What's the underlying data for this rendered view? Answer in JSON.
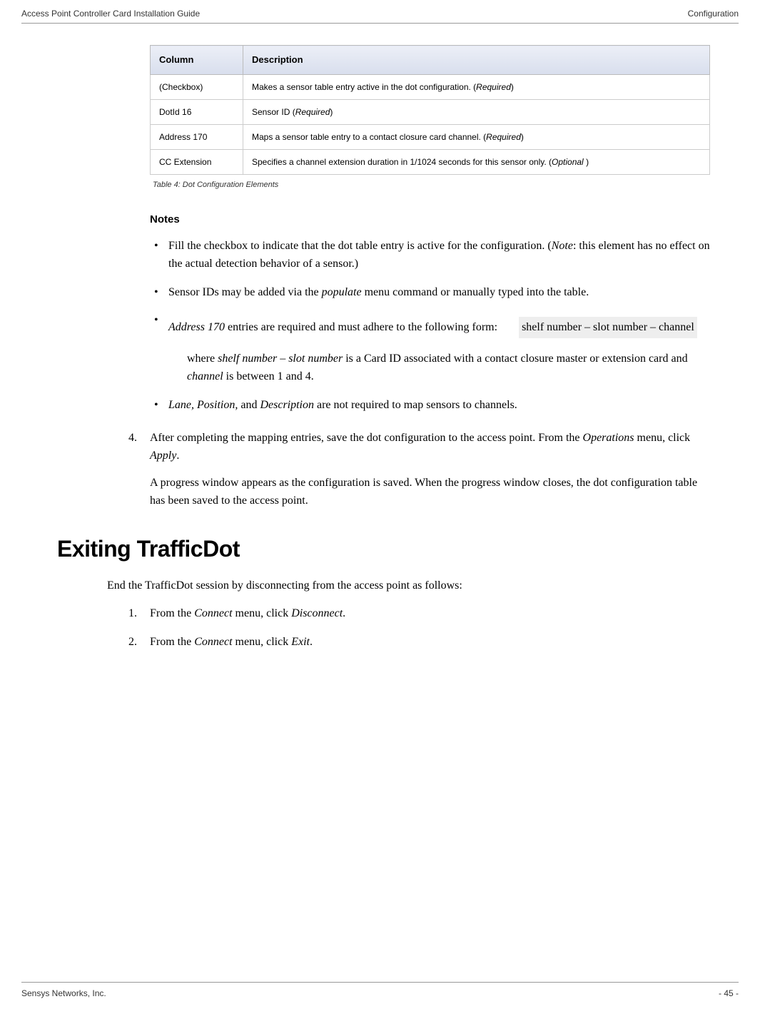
{
  "header": {
    "left": "Access Point Controller Card Installation Guide",
    "right": "Configuration"
  },
  "table": {
    "headers": {
      "col1": "Column",
      "col2": "Description"
    },
    "rows": [
      {
        "col": "(Checkbox)",
        "desc_pre": "Makes a sensor table entry active in the dot configuration. (",
        "req": "Required",
        "desc_post": ")"
      },
      {
        "col": "DotId 16",
        "desc_pre": "Sensor ID (",
        "req": "Required",
        "desc_post": ")"
      },
      {
        "col": "Address 170",
        "desc_pre": "Maps a sensor table entry to a contact closure card channel. (",
        "req": "Required",
        "desc_post": ")"
      },
      {
        "col": "CC Extension",
        "desc_pre": "Specifies a channel extension duration in 1/1024 seconds for this sensor only. (",
        "req": "Optional ",
        "desc_post": ")"
      }
    ],
    "caption": "Table 4: Dot Configuration Elements"
  },
  "notes": {
    "heading": "Notes",
    "items": {
      "n1_a": "Fill the checkbox to indicate that the dot table entry is active for the configuration. (",
      "n1_b": "Note",
      "n1_c": ": this element has no effect on the actual detection behavior of a sensor.)",
      "n2_a": "Sensor IDs may be added via the ",
      "n2_b": "populate",
      "n2_c": " menu command or manually typed into the table.",
      "n3_a": "Address 170",
      "n3_b": " entries are required and must adhere to the following form:",
      "n3_code": "shelf number – slot number – channel",
      "n3_sub_a": "where ",
      "n3_sub_b": "shelf number – slot number",
      "n3_sub_c": " is a Card ID associated with a contact closure master or extension card and ",
      "n3_sub_d": "channel",
      "n3_sub_e": " is between 1 and 4.",
      "n4_a": "Lane, Position,",
      "n4_b": " and ",
      "n4_c": "Description",
      "n4_d": " are not required to map sensors to channels."
    }
  },
  "step4": {
    "num": "4.",
    "line1_a": "After completing the mapping entries, save the dot configuration to the access point. From the ",
    "line1_b": "Operations",
    "line1_c": " menu, click ",
    "line1_d": "Apply",
    "line1_e": ".",
    "line2": "A progress window appears as the configuration is saved. When the progress window closes, the dot configuration table has been saved to the access point."
  },
  "exit": {
    "heading": "Exiting TrafficDot",
    "intro": "End the TrafficDot session by disconnecting from the access point as follows:",
    "s1_num": "1.",
    "s1_a": "From the ",
    "s1_b": "Connect",
    "s1_c": " menu, click ",
    "s1_d": "Disconnect",
    "s1_e": ".",
    "s2_num": "2.",
    "s2_a": "From the ",
    "s2_b": "Connect",
    "s2_c": " menu, click ",
    "s2_d": "Exit",
    "s2_e": "."
  },
  "footer": {
    "left": "Sensys Networks, Inc.",
    "right": "- 45 -"
  }
}
